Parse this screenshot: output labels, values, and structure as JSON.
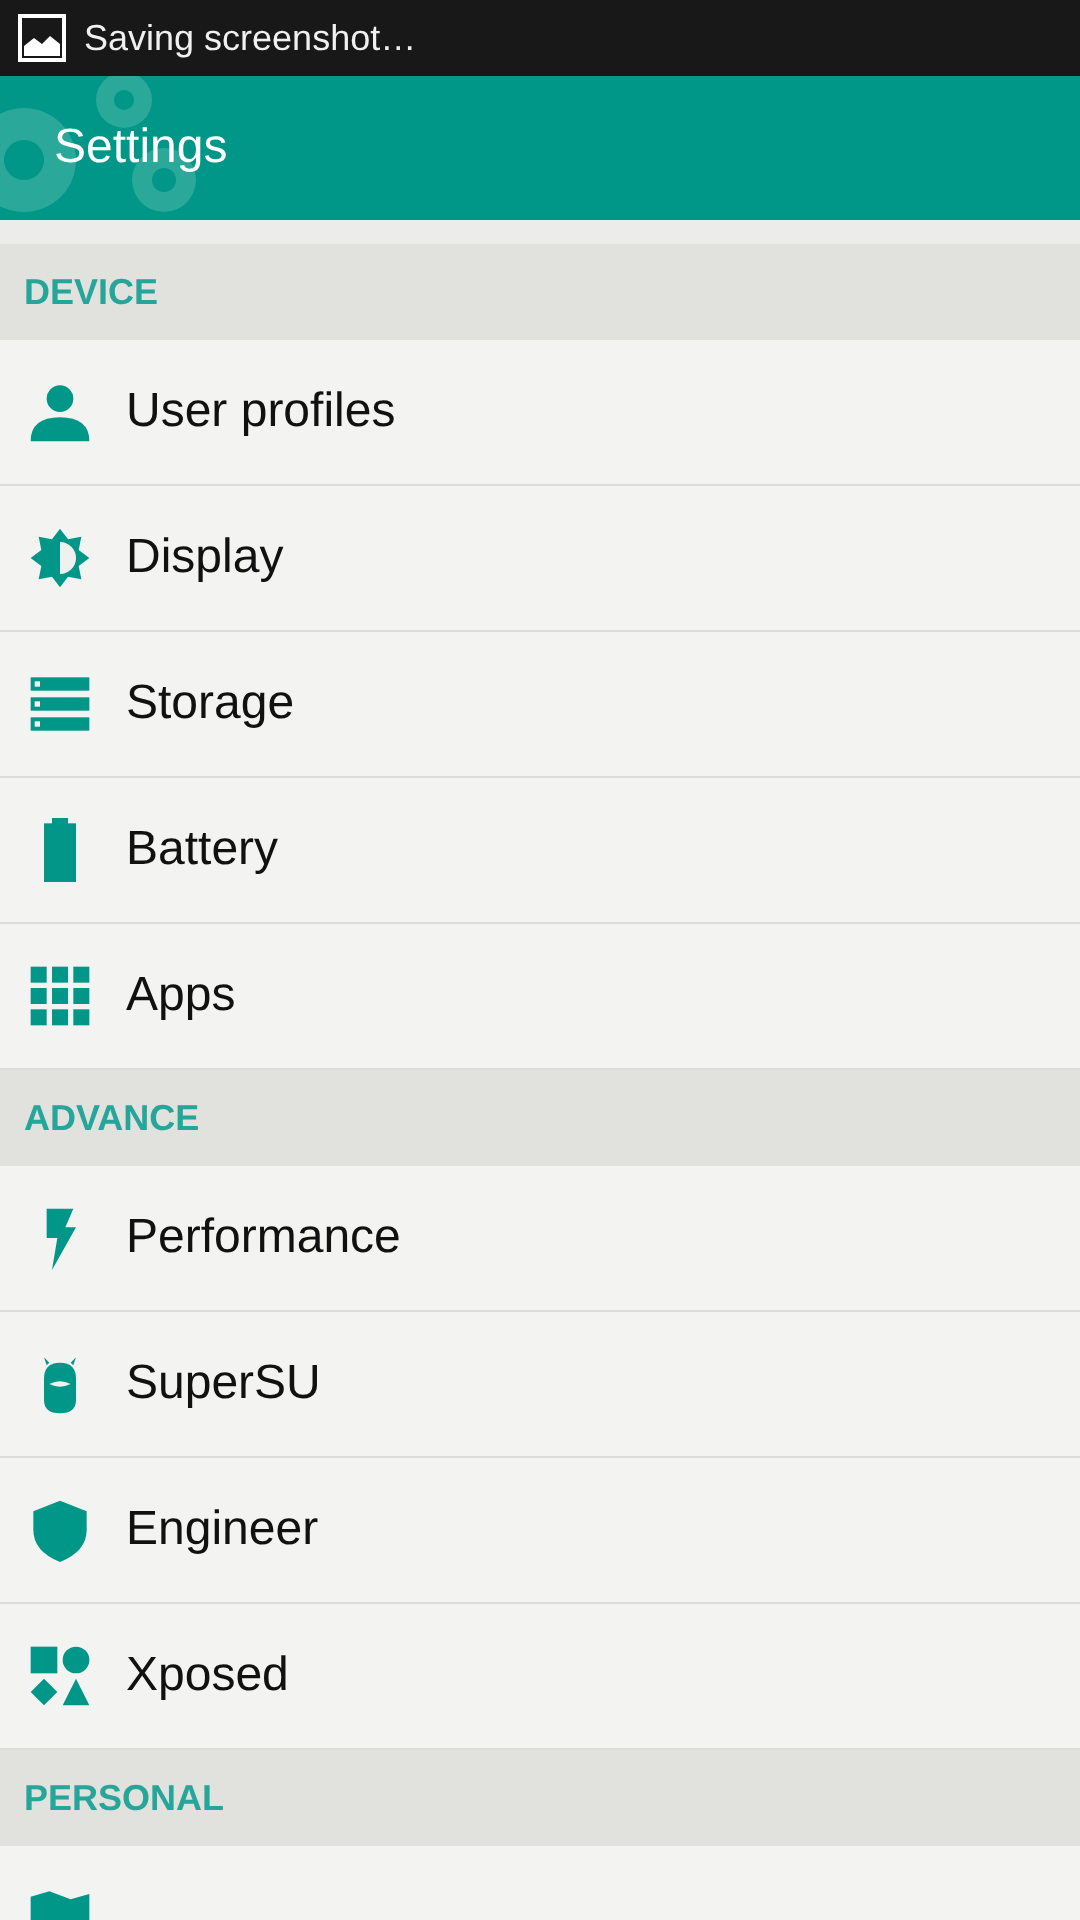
{
  "status_bar": {
    "notification": "Saving screenshot…"
  },
  "toolbar": {
    "title": "Settings"
  },
  "sections": [
    {
      "header": "DEVICE",
      "items": [
        {
          "label": "User profiles",
          "kind": "person"
        },
        {
          "label": "Display",
          "kind": "brightness"
        },
        {
          "label": "Storage",
          "kind": "storage"
        },
        {
          "label": "Battery",
          "kind": "battery"
        },
        {
          "label": "Apps",
          "kind": "grid"
        }
      ]
    },
    {
      "header": "ADVANCE",
      "items": [
        {
          "label": "Performance",
          "kind": "bolt"
        },
        {
          "label": "SuperSU",
          "kind": "robot"
        },
        {
          "label": "Engineer",
          "kind": "shield"
        },
        {
          "label": "Xposed",
          "kind": "shapes"
        }
      ]
    },
    {
      "header": "PERSONAL",
      "items": [
        {
          "kind": "map"
        }
      ]
    }
  ]
}
